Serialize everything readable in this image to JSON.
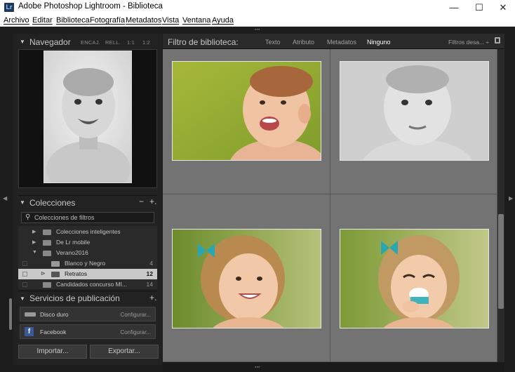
{
  "window": {
    "app_icon": "Lr",
    "title": "Adobe Photoshop Lightroom - Biblioteca",
    "minimize": "—",
    "maximize": "☐",
    "close": "✕"
  },
  "menu": [
    "Archivo",
    "Editar",
    "Biblioteca",
    "Fotografía",
    "Metadatos",
    "Vista",
    "Ventana",
    "Ayuda"
  ],
  "navigator": {
    "title": "Navegador",
    "zoom": [
      "ENCAJ.",
      "RELL.",
      "1:1",
      "1:2"
    ]
  },
  "collections": {
    "title": "Colecciones",
    "minus": "−",
    "plus": "+.",
    "filter_placeholder": "Colecciones de filtros",
    "rows": [
      {
        "label": "Colecciones inteligentes",
        "count": ""
      },
      {
        "label": "De Lr mobile",
        "count": ""
      },
      {
        "label": "Verano2016",
        "count": ""
      },
      {
        "label": "Blanco y Negro",
        "count": "4"
      },
      {
        "label": "Retratos",
        "count": "12"
      },
      {
        "label": "Candidados concurso MI...",
        "count": "14"
      }
    ]
  },
  "publish": {
    "title": "Servicios de publicación",
    "plus": "+.",
    "services": [
      {
        "name": "Disco duro",
        "action": "Configurar..."
      },
      {
        "name": "Facebook",
        "action": "Configurar..."
      }
    ]
  },
  "buttons": {
    "import": "Importar...",
    "export": "Exportar..."
  },
  "library_filter": {
    "label": "Filtro de biblioteca:",
    "options": [
      "Texto",
      "Atributo",
      "Metadatos",
      "Ninguno"
    ],
    "selected": "Ninguno",
    "preset": "Filtros desa... ÷"
  },
  "colors": {
    "panel": "#222222",
    "grid_bg": "#737373",
    "selected_row": "#c9c9c9"
  }
}
